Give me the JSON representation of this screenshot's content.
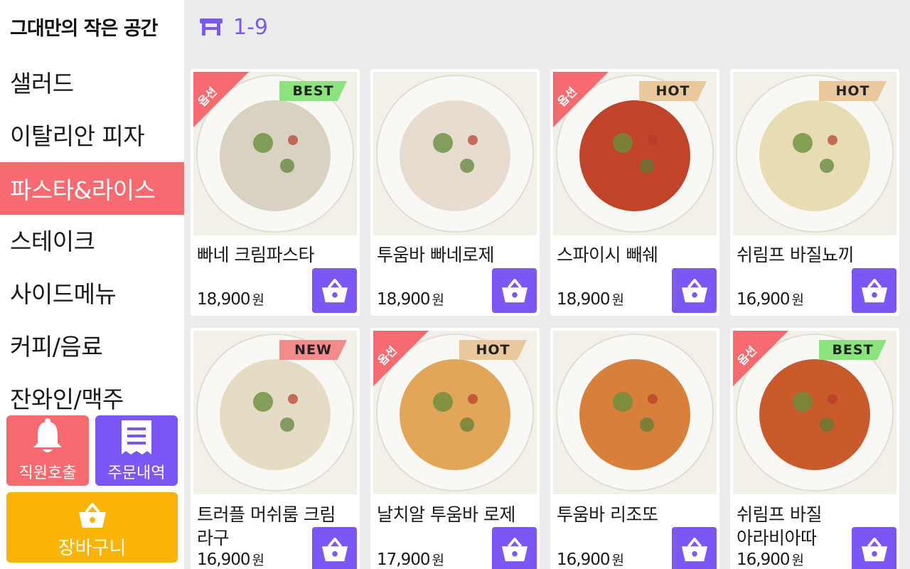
{
  "brand": "그대만의 작은 공간",
  "categories": [
    "샐러드",
    "이탈리안 피자",
    "파스타&라이스",
    "스테이크",
    "사이드메뉴",
    "커피/음료",
    "잔와인/맥주"
  ],
  "active_category": "파스타&라이스",
  "table_label": "1-9",
  "buttons": {
    "call": "직원호출",
    "history": "주문내역",
    "cart": "장바구니"
  },
  "currency": "원",
  "products": [
    {
      "name": "빠네 크림파스타",
      "price": "18,900",
      "option": "옵션",
      "badge": "BEST",
      "badge_color": "#8be37e",
      "dish": "#d8d2c3"
    },
    {
      "name": "투움바 빠네로제",
      "price": "18,900",
      "option": "",
      "badge": "",
      "badge_color": "",
      "dish": "#e6ddd0"
    },
    {
      "name": "스파이시 빼쉐",
      "price": "18,900",
      "option": "옵션",
      "badge": "HOT",
      "badge_color": "#e9c99b",
      "dish": "#c0442a"
    },
    {
      "name": "쉬림프 바질뇨끼",
      "price": "16,900",
      "option": "",
      "badge": "HOT",
      "badge_color": "#e9c99b",
      "dish": "#e8dcb4"
    },
    {
      "name": "트러플 머쉬룸 크림 라구",
      "price": "16,900",
      "option": "",
      "badge": "NEW",
      "badge_color": "#f38a8c",
      "dish": "#e5dcc6"
    },
    {
      "name": "날치알 투움바 로제",
      "price": "17,900",
      "option": "옵션",
      "badge": "HOT",
      "badge_color": "#e9c99b",
      "dish": "#e3a557"
    },
    {
      "name": "투움바 리조또",
      "price": "16,900",
      "option": "",
      "badge": "",
      "badge_color": "",
      "dish": "#d7803b"
    },
    {
      "name": "쉬림프 바질 아라비아따",
      "price": "16,900",
      "option": "옵션",
      "badge": "BEST",
      "badge_color": "#8be37e",
      "dish": "#c95a2c"
    }
  ],
  "colors": {
    "accent": "#7b57f5",
    "active_category": "#f76a6f",
    "cart": "#fbb405"
  },
  "icons": {
    "table": "table-icon",
    "bell": "bell-icon",
    "receipt": "receipt-icon",
    "basket": "basket-icon"
  }
}
